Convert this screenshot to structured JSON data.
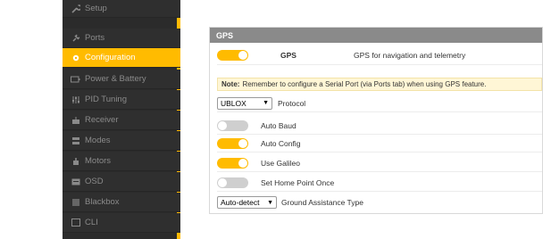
{
  "sidebar": {
    "items": [
      {
        "label": "Setup",
        "icon": "wrench-icon"
      },
      {
        "label": "Ports",
        "icon": "plug-icon"
      },
      {
        "label": "Configuration",
        "icon": "gear-icon",
        "active": true
      },
      {
        "label": "Power & Battery",
        "icon": "battery-icon"
      },
      {
        "label": "PID Tuning",
        "icon": "tuning-icon"
      },
      {
        "label": "Receiver",
        "icon": "receiver-icon"
      },
      {
        "label": "Modes",
        "icon": "modes-icon"
      },
      {
        "label": "Motors",
        "icon": "motor-icon"
      },
      {
        "label": "OSD",
        "icon": "osd-icon"
      },
      {
        "label": "Blackbox",
        "icon": "blackbox-icon"
      },
      {
        "label": "CLI",
        "icon": "cli-icon"
      }
    ]
  },
  "gps": {
    "header": "GPS",
    "main_toggle": {
      "label": "GPS",
      "description": "GPS for navigation and telemetry",
      "on": true
    },
    "note": {
      "bold": "Note:",
      "text": "Remember to configure a Serial Port (via Ports tab) when using GPS feature."
    },
    "protocol": {
      "value": "UBLOX",
      "label": "Protocol"
    },
    "options": [
      {
        "label": "Auto Baud",
        "on": false
      },
      {
        "label": "Auto Config",
        "on": true
      },
      {
        "label": "Use Galileo",
        "on": true
      },
      {
        "label": "Set Home Point Once",
        "on": false
      }
    ],
    "ground_assistance": {
      "value": "Auto-detect",
      "label": "Ground Assistance Type"
    }
  },
  "colors": {
    "accent": "#ffbb00",
    "sidebar_bg": "#2f2f2f",
    "header_bg": "#8a8a8a"
  }
}
